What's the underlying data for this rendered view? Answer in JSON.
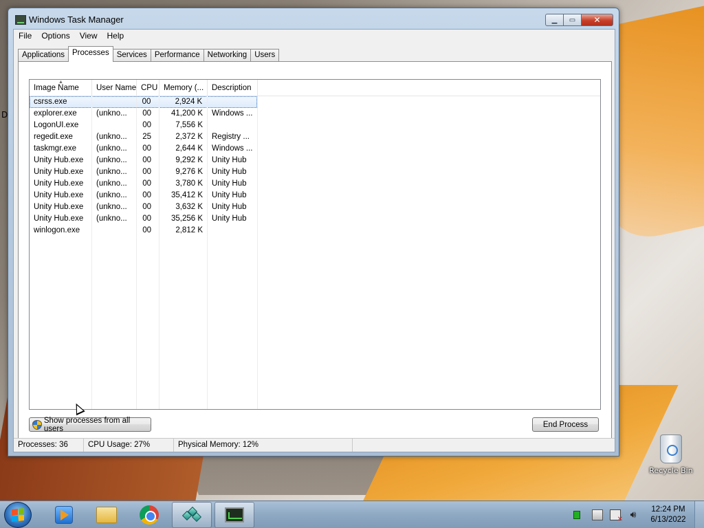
{
  "window": {
    "title": "Windows Task Manager",
    "min_glyph": "▁",
    "max_glyph": "▭",
    "close_glyph": "✕"
  },
  "menu": [
    "File",
    "Options",
    "View",
    "Help"
  ],
  "tabs": [
    "Applications",
    "Processes",
    "Services",
    "Performance",
    "Networking",
    "Users"
  ],
  "active_tab": "Processes",
  "columns": [
    "Image Name",
    "User Name",
    "CPU",
    "Memory (...",
    "Description"
  ],
  "processes": [
    {
      "name": "csrss.exe",
      "user": "",
      "cpu": "00",
      "mem": "2,924 K",
      "desc": ""
    },
    {
      "name": "explorer.exe",
      "user": "(unkno...",
      "cpu": "00",
      "mem": "41,200 K",
      "desc": "Windows ..."
    },
    {
      "name": "LogonUI.exe",
      "user": "",
      "cpu": "00",
      "mem": "7,556 K",
      "desc": ""
    },
    {
      "name": "regedit.exe",
      "user": "(unkno...",
      "cpu": "25",
      "mem": "2,372 K",
      "desc": "Registry ..."
    },
    {
      "name": "taskmgr.exe",
      "user": "(unkno...",
      "cpu": "00",
      "mem": "2,644 K",
      "desc": "Windows ..."
    },
    {
      "name": "Unity Hub.exe",
      "user": "(unkno...",
      "cpu": "00",
      "mem": "9,292 K",
      "desc": "Unity Hub"
    },
    {
      "name": "Unity Hub.exe",
      "user": "(unkno...",
      "cpu": "00",
      "mem": "9,276 K",
      "desc": "Unity Hub"
    },
    {
      "name": "Unity Hub.exe",
      "user": "(unkno...",
      "cpu": "00",
      "mem": "3,780 K",
      "desc": "Unity Hub"
    },
    {
      "name": "Unity Hub.exe",
      "user": "(unkno...",
      "cpu": "00",
      "mem": "35,412 K",
      "desc": "Unity Hub"
    },
    {
      "name": "Unity Hub.exe",
      "user": "(unkno...",
      "cpu": "00",
      "mem": "3,632 K",
      "desc": "Unity Hub"
    },
    {
      "name": "Unity Hub.exe",
      "user": "(unkno...",
      "cpu": "00",
      "mem": "35,256 K",
      "desc": "Unity Hub"
    },
    {
      "name": "winlogon.exe",
      "user": "",
      "cpu": "00",
      "mem": "2,812 K",
      "desc": ""
    }
  ],
  "selected_row": "csrss.exe",
  "buttons": {
    "show_all": "Show processes from all users",
    "end_process": "End Process"
  },
  "status": {
    "processes": "Processes: 36",
    "cpu": "CPU Usage: 27%",
    "memory": "Physical Memory: 12%"
  },
  "desktop": {
    "recycle_bin": "Recycle Bin",
    "edge_letter": "D"
  },
  "taskbar": {
    "apps": [
      "media-player-icon",
      "file-explorer-icon",
      "chrome-icon",
      "registry-editor-icon",
      "task-manager-icon"
    ],
    "time": "12:24 PM",
    "date": "6/13/2022"
  },
  "colors": {
    "selection": "#dcebfc",
    "close_button": "#c8402a",
    "taskbar": "#8fa9c3"
  }
}
